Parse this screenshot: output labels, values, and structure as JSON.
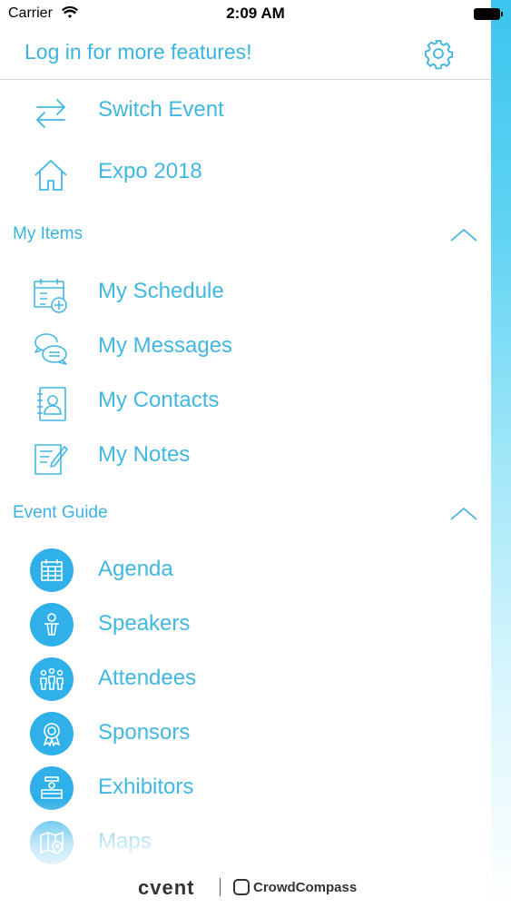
{
  "status_bar": {
    "carrier": "Carrier",
    "time": "2:09 AM"
  },
  "header": {
    "login_text": "Log in for more features!"
  },
  "top_items": [
    {
      "label": "Switch Event",
      "icon": "swap-arrows-icon"
    },
    {
      "label": "Expo 2018",
      "icon": "home-icon"
    }
  ],
  "sections": {
    "my_items": {
      "title": "My Items",
      "items": [
        {
          "label": "My Schedule",
          "icon": "calendar-add-icon"
        },
        {
          "label": "My Messages",
          "icon": "chat-bubbles-icon"
        },
        {
          "label": "My Contacts",
          "icon": "contact-book-icon"
        },
        {
          "label": "My Notes",
          "icon": "note-pencil-icon"
        }
      ]
    },
    "event_guide": {
      "title": "Event Guide",
      "items": [
        {
          "label": "Agenda",
          "icon": "calendar-grid-icon"
        },
        {
          "label": "Speakers",
          "icon": "speaker-podium-icon"
        },
        {
          "label": "Attendees",
          "icon": "people-group-icon"
        },
        {
          "label": "Sponsors",
          "icon": "ribbon-badge-icon"
        },
        {
          "label": "Exhibitors",
          "icon": "exhibitor-booth-icon"
        },
        {
          "label": "Maps",
          "icon": "map-pin-icon"
        }
      ]
    }
  },
  "footer": {
    "brand_primary": "cvent",
    "brand_secondary": "CrowdCompass"
  },
  "colors": {
    "accent": "#3bb3e0",
    "icon_circle": "#2fb0e8",
    "divider": "#d9d9d9"
  }
}
